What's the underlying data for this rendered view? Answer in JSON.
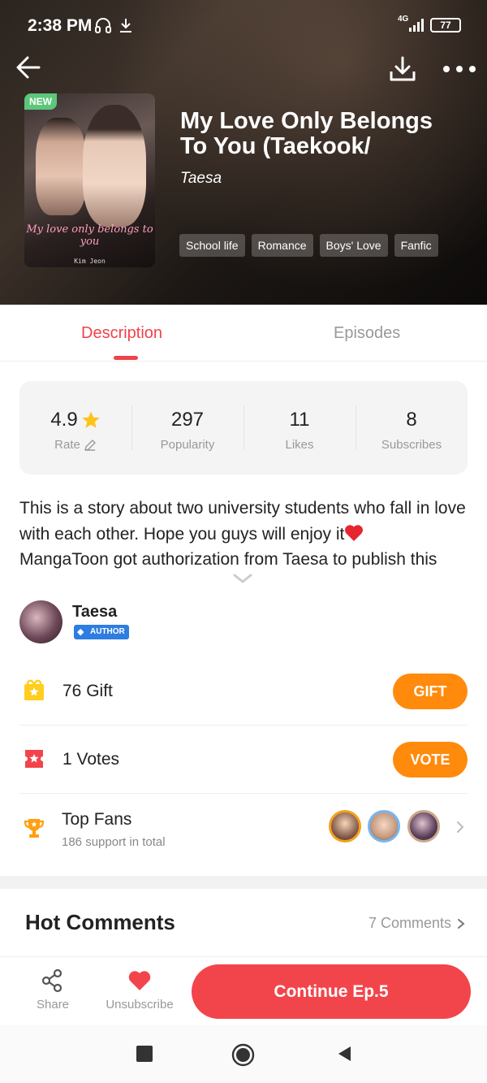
{
  "status_bar": {
    "time": "2:38 PM",
    "network": "4G",
    "battery": "77"
  },
  "book": {
    "badge": "NEW",
    "title": "My Love Only Belongs To You (Taekook/",
    "author": "Taesa",
    "cover_title": "My love only belongs to you",
    "cover_author": "Kim Jeon",
    "tags": [
      "School life",
      "Romance",
      "Boys' Love",
      "Fanfic"
    ]
  },
  "tabs": {
    "description": "Description",
    "episodes": "Episodes"
  },
  "stats": [
    {
      "value": "4.9",
      "label": "Rate"
    },
    {
      "value": "297",
      "label": "Popularity"
    },
    {
      "value": "11",
      "label": "Likes"
    },
    {
      "value": "8",
      "label": "Subscribes"
    }
  ],
  "description": {
    "line1": "This is a story about two university students who fall in love with each other. Hope you guys will enjoy it",
    "line2": "MangaToon got authorization from Taesa to publish this"
  },
  "author_section": {
    "name": "Taesa",
    "badge": "AUTHOR"
  },
  "gift": {
    "label": "76 Gift",
    "button": "GIFT"
  },
  "vote": {
    "label": "1 Votes",
    "button": "VOTE"
  },
  "fans": {
    "title": "Top Fans",
    "subtitle": "186 support in total"
  },
  "hot_comments": {
    "title": "Hot Comments",
    "link": "7 Comments"
  },
  "bottom_bar": {
    "share": "Share",
    "unsubscribe": "Unsubscribe",
    "continue": "Continue Ep.5"
  },
  "colors": {
    "accent": "#f0424a",
    "orange": "#ff8a0c",
    "author_badge": "#2e7de0",
    "new_badge": "#5cc77a"
  }
}
